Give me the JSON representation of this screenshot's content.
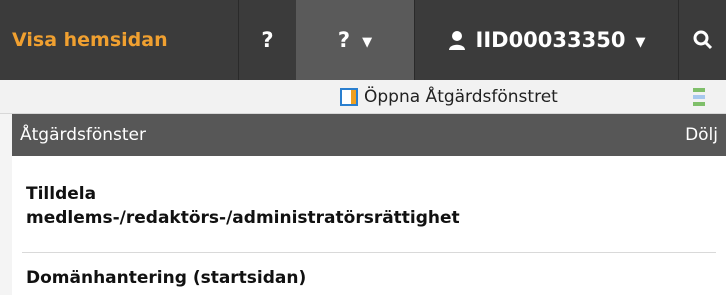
{
  "topbar": {
    "brand_label": "Visa hemsidan",
    "help_label": "?",
    "help_menu_label": "?",
    "user_label": "IID00033350"
  },
  "toolbar": {
    "open_panel_label": "Öppna Åtgärdsfönstret"
  },
  "panel": {
    "title": "Åtgärdsfönster",
    "hide_label": "Dölj",
    "actions": [
      "Tilldela medlems-/redaktörs-/administratörsrättighet",
      "Domänhantering (startsidan)"
    ]
  },
  "colors": {
    "topbar_bg": "#3b3b3b",
    "brand_accent": "#f0a030",
    "panel_header_bg": "#575757",
    "toolbar_bg": "#f2f2f2"
  }
}
